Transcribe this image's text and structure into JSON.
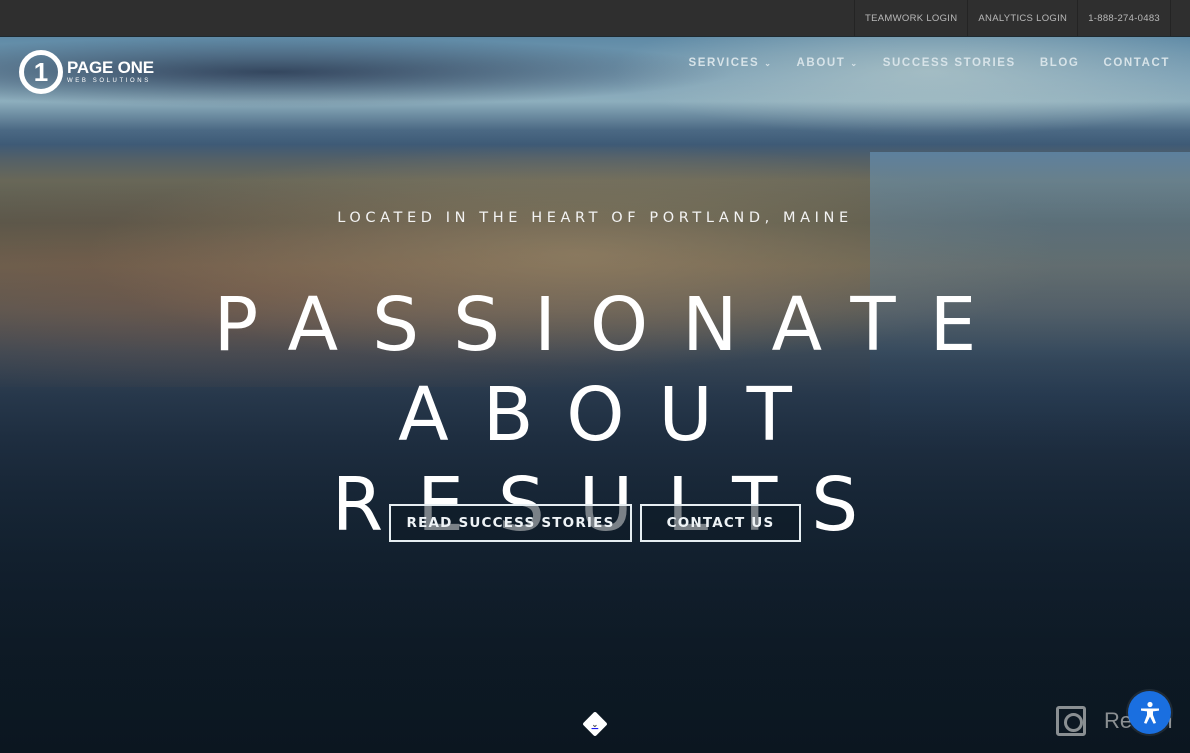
{
  "topbar": {
    "links": [
      {
        "label": "TEAMWORK LOGIN"
      },
      {
        "label": "ANALYTICS LOGIN"
      },
      {
        "label": "1-888-274-0483"
      }
    ]
  },
  "logo": {
    "mark": "1",
    "name": "PAGE ONE",
    "tagline": "WEB SOLUTIONS"
  },
  "nav": {
    "items": [
      {
        "label": "SERVICES",
        "has_dropdown": true,
        "chevron": "⌄"
      },
      {
        "label": "ABOUT",
        "has_dropdown": true,
        "chevron": "⌄"
      },
      {
        "label": "SUCCESS STORIES"
      },
      {
        "label": "BLOG"
      },
      {
        "label": "CONTACT"
      }
    ]
  },
  "hero": {
    "kicker": "LOCATED IN THE HEART OF PORTLAND, MAINE",
    "headline_line1": "PASSIONATE ABOUT",
    "headline_line2": "RESULTS",
    "buttons": {
      "read": "READ SUCCESS STORIES",
      "contact": "CONTACT US"
    },
    "scroll_icon": "⌄"
  },
  "overlays": {
    "watermark": "Revain",
    "accessibility_label": "accessibility-widget",
    "accessibility_color": "#1a6fe0"
  }
}
